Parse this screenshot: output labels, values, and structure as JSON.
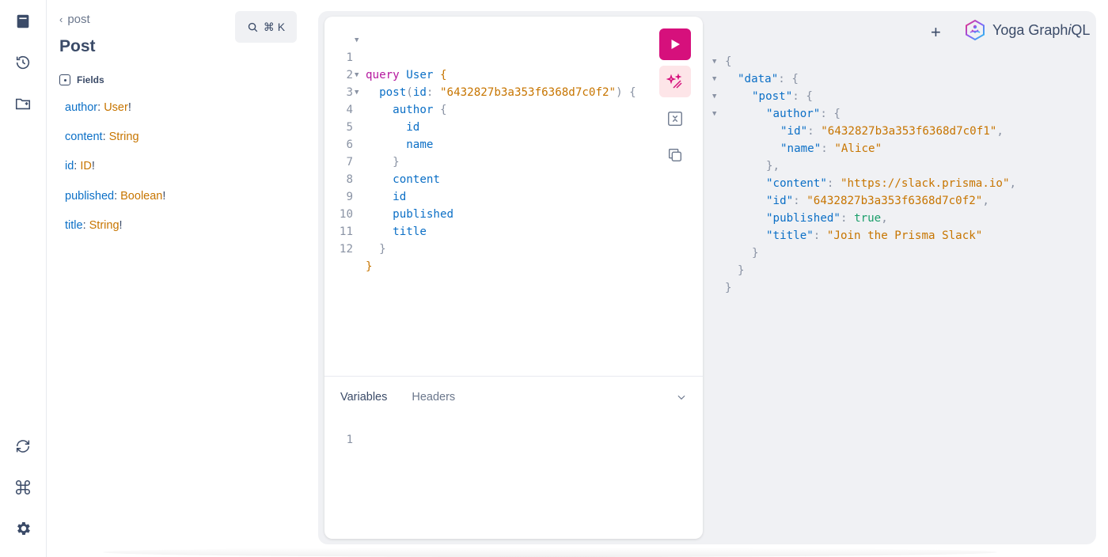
{
  "rail": {
    "items": [
      "docs-icon",
      "history-icon",
      "explorer-icon"
    ],
    "bottom_items": [
      "refetch-schema-icon",
      "shortcuts-icon",
      "settings-icon"
    ]
  },
  "docs": {
    "back_label": "post",
    "title": "Post",
    "search_shortcut": "⌘ K",
    "section_label": "Fields",
    "fields": [
      {
        "name": "author",
        "type": "User",
        "required": "!"
      },
      {
        "name": "content",
        "type": "String",
        "required": ""
      },
      {
        "name": "id",
        "type": "ID",
        "required": "!"
      },
      {
        "name": "published",
        "type": "Boolean",
        "required": "!"
      },
      {
        "name": "title",
        "type": "String",
        "required": "!"
      }
    ]
  },
  "editor": {
    "line_numbers": [
      "1",
      "2",
      "3",
      "4",
      "5",
      "6",
      "7",
      "8",
      "9",
      "10",
      "11",
      "12"
    ],
    "query_keyword": "query",
    "operation_name": "User",
    "post_field": "post",
    "arg_name": "id",
    "arg_value": "\"6432827b3a353f6368d7c0f2\"",
    "fields": {
      "author": "author",
      "id": "id",
      "name": "name",
      "content": "content",
      "published": "published",
      "title": "title"
    }
  },
  "bottom_panel": {
    "tabs": [
      "Variables",
      "Headers"
    ],
    "active_tab": "Variables",
    "variables_line": "1"
  },
  "header": {
    "plus_label": "+",
    "logo_text_a": "Yoga Graph",
    "logo_text_b": "i",
    "logo_text_c": "QL"
  },
  "result": {
    "data_key": "\"data\"",
    "post_key": "\"post\"",
    "author_key": "\"author\"",
    "author_id_key": "\"id\"",
    "author_id_value": "\"6432827b3a353f6368d7c0f1\"",
    "author_name_key": "\"name\"",
    "author_name_value": "\"Alice\"",
    "content_key": "\"content\"",
    "content_value": "\"https://slack.prisma.io\"",
    "id_key": "\"id\"",
    "id_value": "\"6432827b3a353f6368d7c0f2\"",
    "published_key": "\"published\"",
    "published_value": "true",
    "title_key": "\"title\"",
    "title_value": "\"Join the Prisma Slack\""
  },
  "colors": {
    "accent": "#d6107c",
    "field_name": "#0b6fc6",
    "type_name": "#c77500",
    "boolean": "#1a9e6a"
  }
}
